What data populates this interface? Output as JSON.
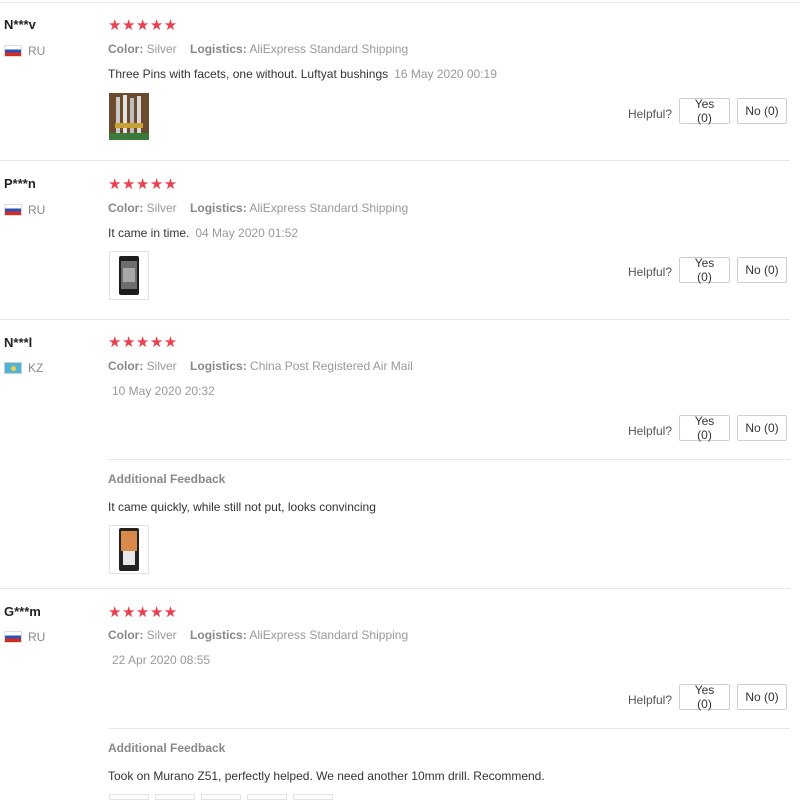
{
  "reviews": [
    {
      "user": "N***v",
      "country": "RU",
      "stars": "★★★★★",
      "color_label": "Color:",
      "color_value": "Silver",
      "logistics_label": "Logistics:",
      "logistics_value": "AliExpress Standard Shipping",
      "text": "Three Pins with facets, one without. Luftyat bushings",
      "date": "16 May 2020 00:19",
      "helpful_label": "Helpful?",
      "yes_label": "Yes (0)",
      "no_label": "No (0)"
    },
    {
      "user": "P***n",
      "country": "RU",
      "stars": "★★★★★",
      "color_label": "Color:",
      "color_value": "Silver",
      "logistics_label": "Logistics:",
      "logistics_value": "AliExpress Standard Shipping",
      "text": "It came in time.",
      "date": "04 May 2020 01:52",
      "helpful_label": "Helpful?",
      "yes_label": "Yes (0)",
      "no_label": "No (0)"
    },
    {
      "user": "N***l",
      "country": "KZ",
      "stars": "★★★★★",
      "color_label": "Color:",
      "color_value": "Silver",
      "logistics_label": "Logistics:",
      "logistics_value": "China Post Registered Air Mail",
      "date": "10 May 2020 20:32",
      "helpful_label": "Helpful?",
      "yes_label": "Yes (0)",
      "no_label": "No (0)",
      "additional_label": "Additional Feedback",
      "additional_text": "It came quickly, while still not put, looks convincing"
    },
    {
      "user": "G***m",
      "country": "RU",
      "stars": "★★★★★",
      "color_label": "Color:",
      "color_value": "Silver",
      "logistics_label": "Logistics:",
      "logistics_value": "AliExpress Standard Shipping",
      "date": "22 Apr 2020 08:55",
      "helpful_label": "Helpful?",
      "yes_label": "Yes (0)",
      "no_label": "No (0)",
      "additional_label": "Additional Feedback",
      "additional_text": "Took on Murano Z51, perfectly helped. We need another 10mm drill. Recommend."
    }
  ]
}
